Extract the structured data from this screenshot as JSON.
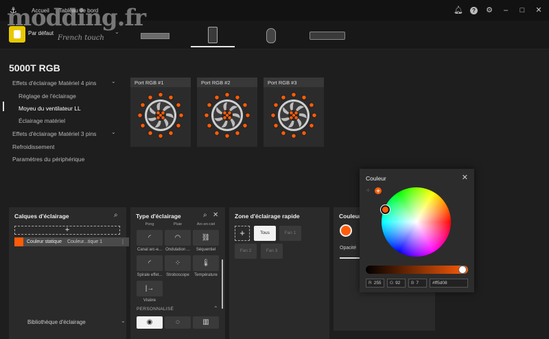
{
  "titlebar": {
    "nav": [
      "Accueil",
      "Tableau de bord"
    ],
    "watermark": "modding.fr",
    "watermark_sub": "French touch"
  },
  "profile": {
    "name": "Par défaut"
  },
  "device": {
    "title": "5000T RGB"
  },
  "sidebar": {
    "items": [
      "Effets d'éclairage Matériel 4 pins",
      "Réglage de l'éclairage",
      "Moyeu du ventilateur LL",
      "Éclairage matériel",
      "Effets d'éclairage Matériel 3 pins",
      "Refroidissement",
      "Paramètres du périphérique"
    ]
  },
  "ports": [
    "Port RGB #1",
    "Port RGB #2",
    "Port RGB #3"
  ],
  "layers": {
    "title": "Calques d'éclairage",
    "add": "+",
    "row_name": "Couleur statique",
    "row_sub": "Couleur...tique 1",
    "row_menu": "⋮",
    "library": "Bibliothèque d'éclairage"
  },
  "effects": {
    "title": "Type d'éclairage",
    "top_cut": [
      "Pong",
      "Pluie",
      "Arc-en-ciel"
    ],
    "row1": [
      "Canal arc-e...",
      "Ondulation ...",
      "Séquentiel"
    ],
    "row2": [
      "Spirale effet...",
      "Stroboscope",
      "Température"
    ],
    "row3": [
      "Visière"
    ],
    "section": "PERSONNALISÉ"
  },
  "zones": {
    "title": "Zone d'éclairage rapide",
    "add": "+",
    "buttons": [
      "Tous",
      "Fan 1",
      "Fan 2",
      "Fan 3"
    ]
  },
  "couleur_panel": {
    "title": "Couleur",
    "opacity": "Opacité"
  },
  "color_popup": {
    "title": "Couleur",
    "add": "+",
    "r_label": "R",
    "r": "255",
    "g_label": "G",
    "g": "92",
    "b_label": "B",
    "b": "7",
    "hex": "#ff5d08"
  },
  "colors": {
    "accent": "#ff5c08",
    "badge": "#e8c800"
  },
  "icons": [
    "corsair-logo-icon",
    "bell-icon",
    "help-icon",
    "gear-icon",
    "minimize-icon",
    "maximize-icon",
    "close-icon",
    "search-icon",
    "chevron-down-icon",
    "grid-icon"
  ]
}
